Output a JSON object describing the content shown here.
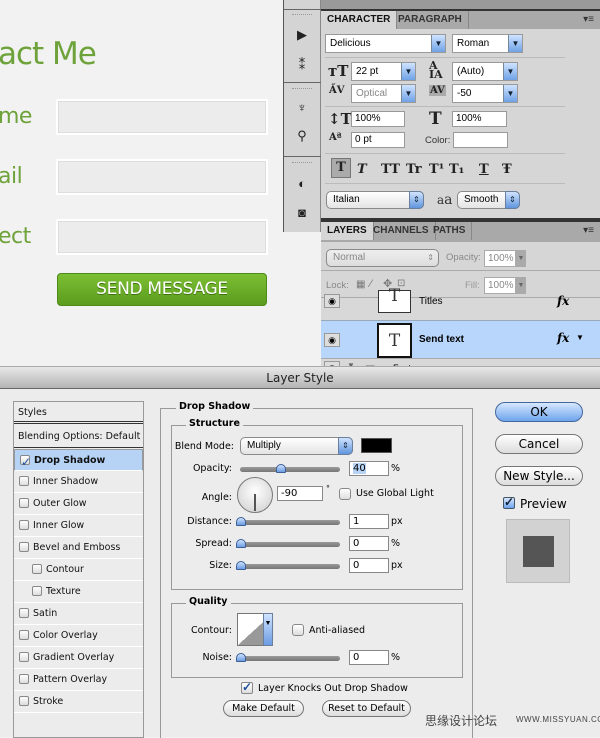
{
  "web_form": {
    "title": "act Me",
    "labels": [
      "me",
      "ail",
      "ect"
    ],
    "send_button": "SEND MESSAGE",
    "accent_color": "#6ea23a"
  },
  "tool_strip": {
    "icons": [
      "play-icon",
      "history-icon",
      "brushes-icon",
      "clone-source-icon",
      "adjustments-icon",
      "mask-icon"
    ]
  },
  "character_panel": {
    "tabs": [
      "CHARACTER",
      "PARAGRAPH"
    ],
    "font_family": "Delicious",
    "font_style": "Roman",
    "font_size": "22 pt",
    "leading": "(Auto)",
    "kerning": "Optical",
    "tracking": "-50",
    "vertical_scale": "100%",
    "horizontal_scale": "100%",
    "baseline_shift": "0 pt",
    "color_label": "Color:",
    "format_buttons": [
      "T",
      "T",
      "TT",
      "Tr",
      "T¹",
      "T₁",
      "T",
      "Ŧ"
    ],
    "language": "Italian",
    "aa_label": "a",
    "antialias": "Smooth"
  },
  "layers_panel": {
    "tabs": [
      "LAYERS",
      "CHANNELS",
      "PATHS"
    ],
    "blend_mode": "Normal",
    "opacity_label": "Opacity:",
    "opacity": "100%",
    "lock_label": "Lock:",
    "fill_label": "Fill:",
    "fill": "100%",
    "layers": [
      {
        "name": "Titles",
        "type": "text",
        "fx": "fx"
      },
      {
        "name": "Send text",
        "type": "text",
        "fx": "fx",
        "selected": true
      },
      {
        "name": "Footer",
        "type": "group"
      }
    ]
  },
  "layer_style": {
    "title": "Layer Style",
    "styles_header": "Styles",
    "blending_options": "Blending Options: Default",
    "style_items": [
      {
        "label": "Drop Shadow",
        "checked": true,
        "selected": true,
        "indent": false
      },
      {
        "label": "Inner Shadow",
        "checked": false,
        "indent": false
      },
      {
        "label": "Outer Glow",
        "checked": false,
        "indent": false
      },
      {
        "label": "Inner Glow",
        "checked": false,
        "indent": false
      },
      {
        "label": "Bevel and Emboss",
        "checked": false,
        "indent": false
      },
      {
        "label": "Contour",
        "checked": false,
        "indent": true
      },
      {
        "label": "Texture",
        "checked": false,
        "indent": true
      },
      {
        "label": "Satin",
        "checked": false,
        "indent": false
      },
      {
        "label": "Color Overlay",
        "checked": false,
        "indent": false
      },
      {
        "label": "Gradient Overlay",
        "checked": false,
        "indent": false
      },
      {
        "label": "Pattern Overlay",
        "checked": false,
        "indent": false
      },
      {
        "label": "Stroke",
        "checked": false,
        "indent": false
      }
    ],
    "section_title": "Drop Shadow",
    "structure": {
      "legend": "Structure",
      "blend_mode_label": "Blend Mode:",
      "blend_mode": "Multiply",
      "shadow_color": "#000000",
      "opacity_label": "Opacity:",
      "opacity": "40",
      "opacity_unit": "%",
      "angle_label": "Angle:",
      "angle": "-90",
      "angle_unit": "°",
      "use_global_light": "Use Global Light",
      "use_global_light_checked": false,
      "distance_label": "Distance:",
      "distance": "1",
      "distance_unit": "px",
      "spread_label": "Spread:",
      "spread": "0",
      "spread_unit": "%",
      "size_label": "Size:",
      "size": "0",
      "size_unit": "px"
    },
    "quality": {
      "legend": "Quality",
      "contour_label": "Contour:",
      "anti_aliased": "Anti-aliased",
      "anti_aliased_checked": false,
      "noise_label": "Noise:",
      "noise": "0",
      "noise_unit": "%"
    },
    "knockout": "Layer Knocks Out Drop Shadow",
    "knockout_checked": true,
    "make_default": "Make Default",
    "reset_default": "Reset to Default",
    "buttons": {
      "ok": "OK",
      "cancel": "Cancel",
      "new_style": "New Style..."
    },
    "preview_label": "Preview",
    "preview_checked": true
  },
  "watermark": {
    "cn": "思缘设计论坛",
    "url": "WWW.MISSYUAN.COM"
  }
}
